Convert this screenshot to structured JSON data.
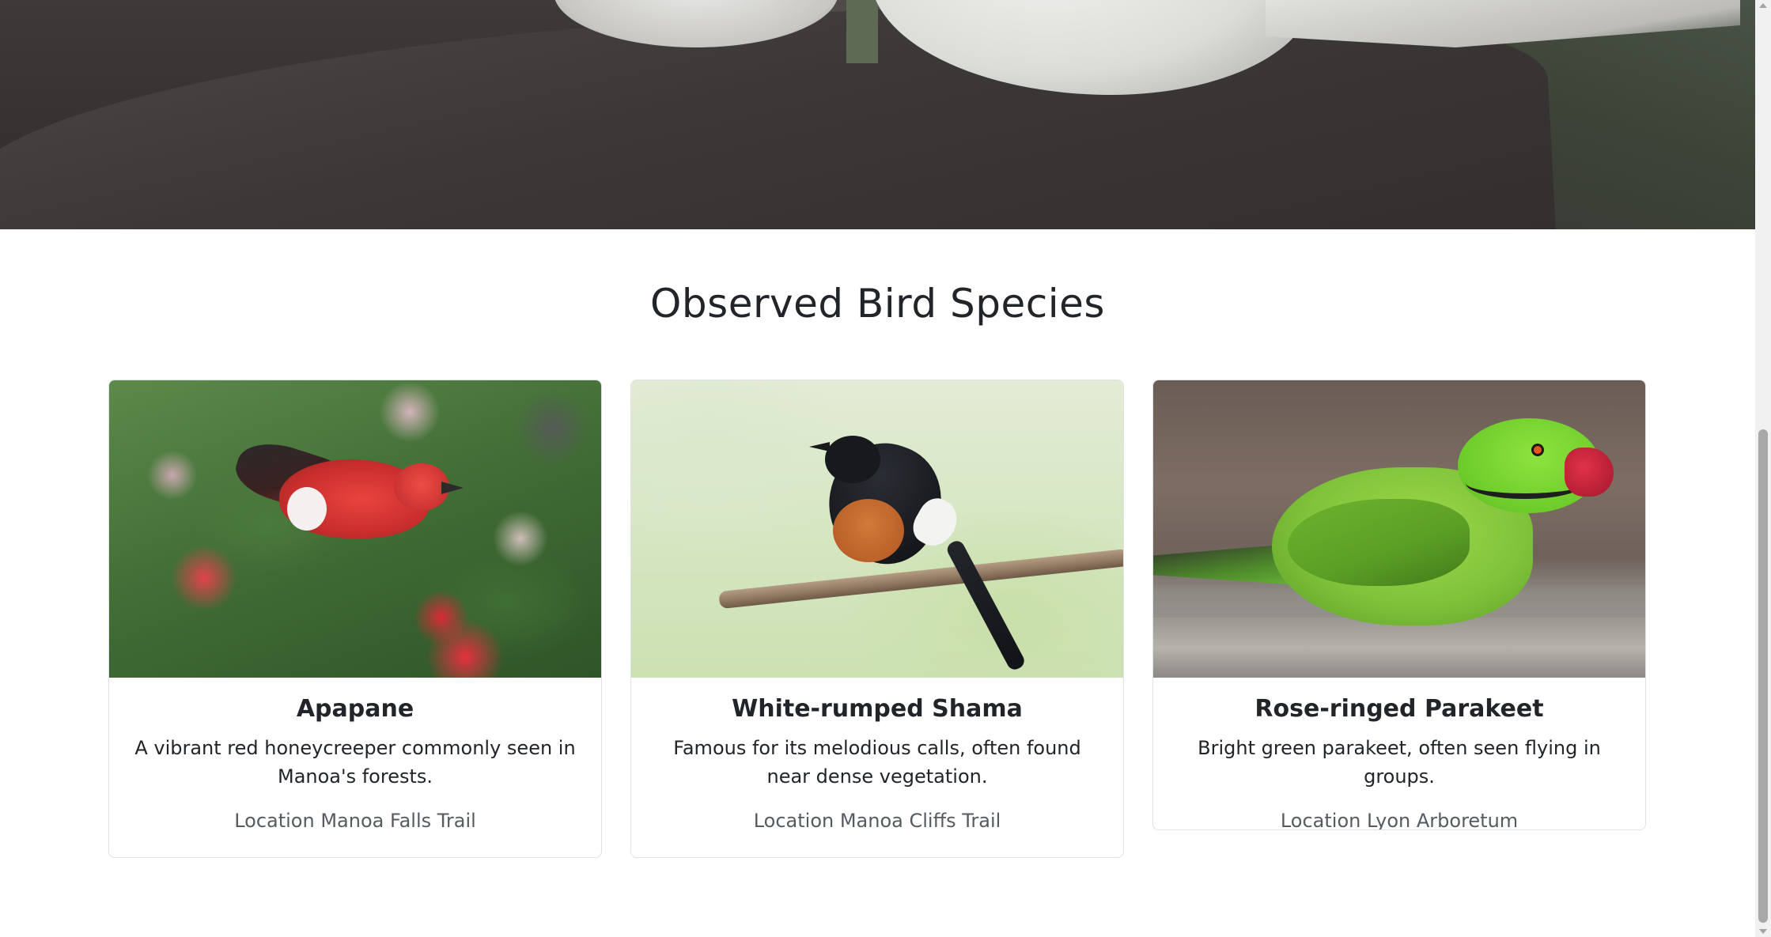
{
  "section": {
    "title": "Observed Bird Species"
  },
  "birds": [
    {
      "name": "Apapane",
      "description": "A vibrant red honeycreeper commonly seen in Manoa's forests.",
      "location": "Location Manoa Falls Trail"
    },
    {
      "name": "White-rumped Shama",
      "description": "Famous for its melodious calls, often found near dense vegetation.",
      "location": "Location Manoa Cliffs Trail"
    },
    {
      "name": "Rose-ringed Parakeet",
      "description": "Bright green parakeet, often seen flying in groups.",
      "location": "Location Lyon Arboretum"
    }
  ],
  "colors": {
    "text": "#212529",
    "muted_text": "#555b61",
    "card_border": "#dee2e6",
    "background": "#ffffff"
  },
  "icons": {
    "scroll_up": "triangle-up-icon",
    "scroll_down": "triangle-down-icon"
  }
}
